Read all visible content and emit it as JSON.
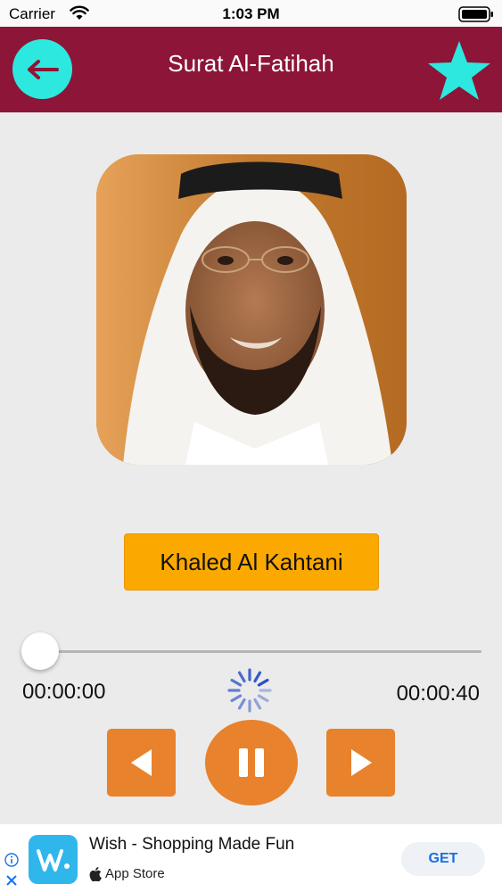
{
  "status_bar": {
    "carrier": "Carrier",
    "time": "1:03 PM",
    "icons": [
      "wifi-icon",
      "battery-icon"
    ]
  },
  "nav": {
    "title": "Surat Al-Fatihah",
    "back_icon": "arrow-left-icon",
    "favorite_icon": "star-icon",
    "bar_color": "#8c1538",
    "accent_color": "#2de8de"
  },
  "reciter": {
    "name": "Khaled Al Kahtani",
    "photo": "reciter-portrait"
  },
  "player": {
    "elapsed": "00:00:00",
    "duration": "00:00:40",
    "progress": 0,
    "state": "loading",
    "controls": {
      "prev_icon": "previous-icon",
      "pause_icon": "pause-icon",
      "next_icon": "next-icon"
    },
    "control_color": "#e8822c"
  },
  "ad": {
    "title": "Wish - Shopping Made Fun",
    "store": "App Store",
    "cta": "GET",
    "app_icon": "wish-logo-icon"
  }
}
